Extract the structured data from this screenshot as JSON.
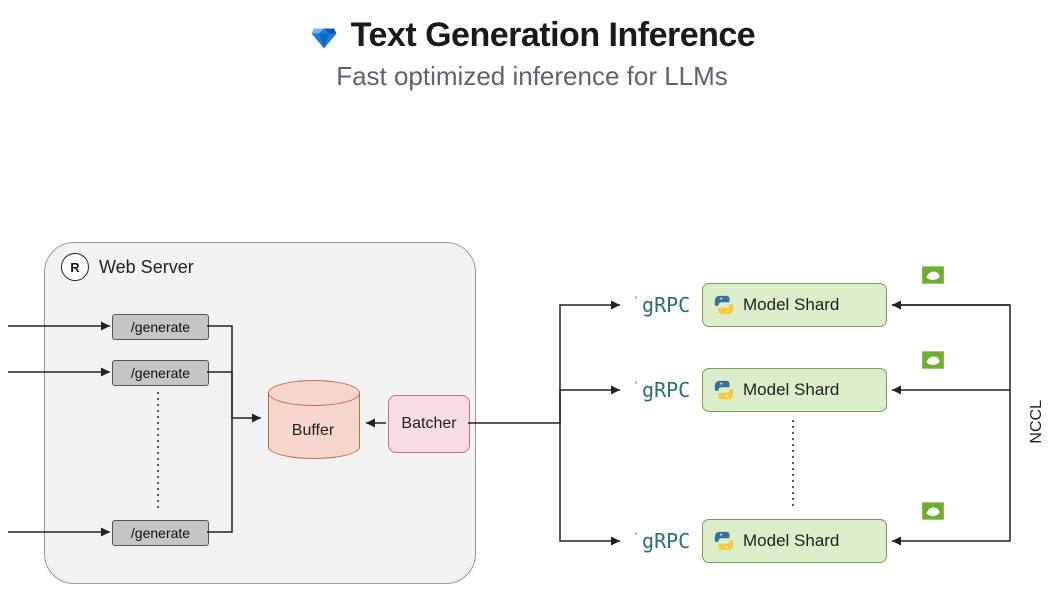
{
  "header": {
    "title": "Text Generation Inference",
    "subtitle": "Fast optimized inference for LLMs",
    "logo": "blue-gem"
  },
  "server": {
    "tech": "rust",
    "label": "Web Server",
    "endpoints": [
      "/generate",
      "/generate",
      "/generate"
    ]
  },
  "buffer": {
    "label": "Buffer"
  },
  "batcher": {
    "label": "Batcher"
  },
  "transport": {
    "label": "gRPC",
    "count": 3
  },
  "shards": [
    {
      "runtime": "python",
      "label": "Model Shard",
      "gpu": "nvidia"
    },
    {
      "runtime": "python",
      "label": "Model Shard",
      "gpu": "nvidia"
    },
    {
      "runtime": "python",
      "label": "Model Shard",
      "gpu": "nvidia"
    }
  ],
  "interconnect": {
    "label": "NCCL"
  }
}
